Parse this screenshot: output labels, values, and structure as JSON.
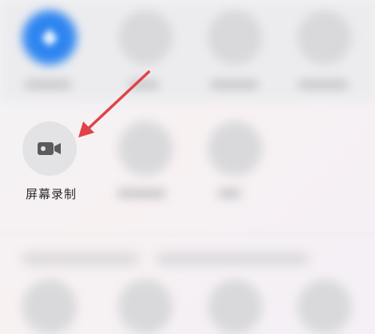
{
  "screen_record": {
    "label": "屏幕录制",
    "icon": "video-camera-icon"
  },
  "annotation": {
    "type": "arrow",
    "color": "#e0424b"
  },
  "colors": {
    "active_tile": "#2f86f0",
    "inactive_tile": "#d9d9db",
    "focused_tile": "#e3e3e5",
    "label_text": "#2b2b2b"
  }
}
